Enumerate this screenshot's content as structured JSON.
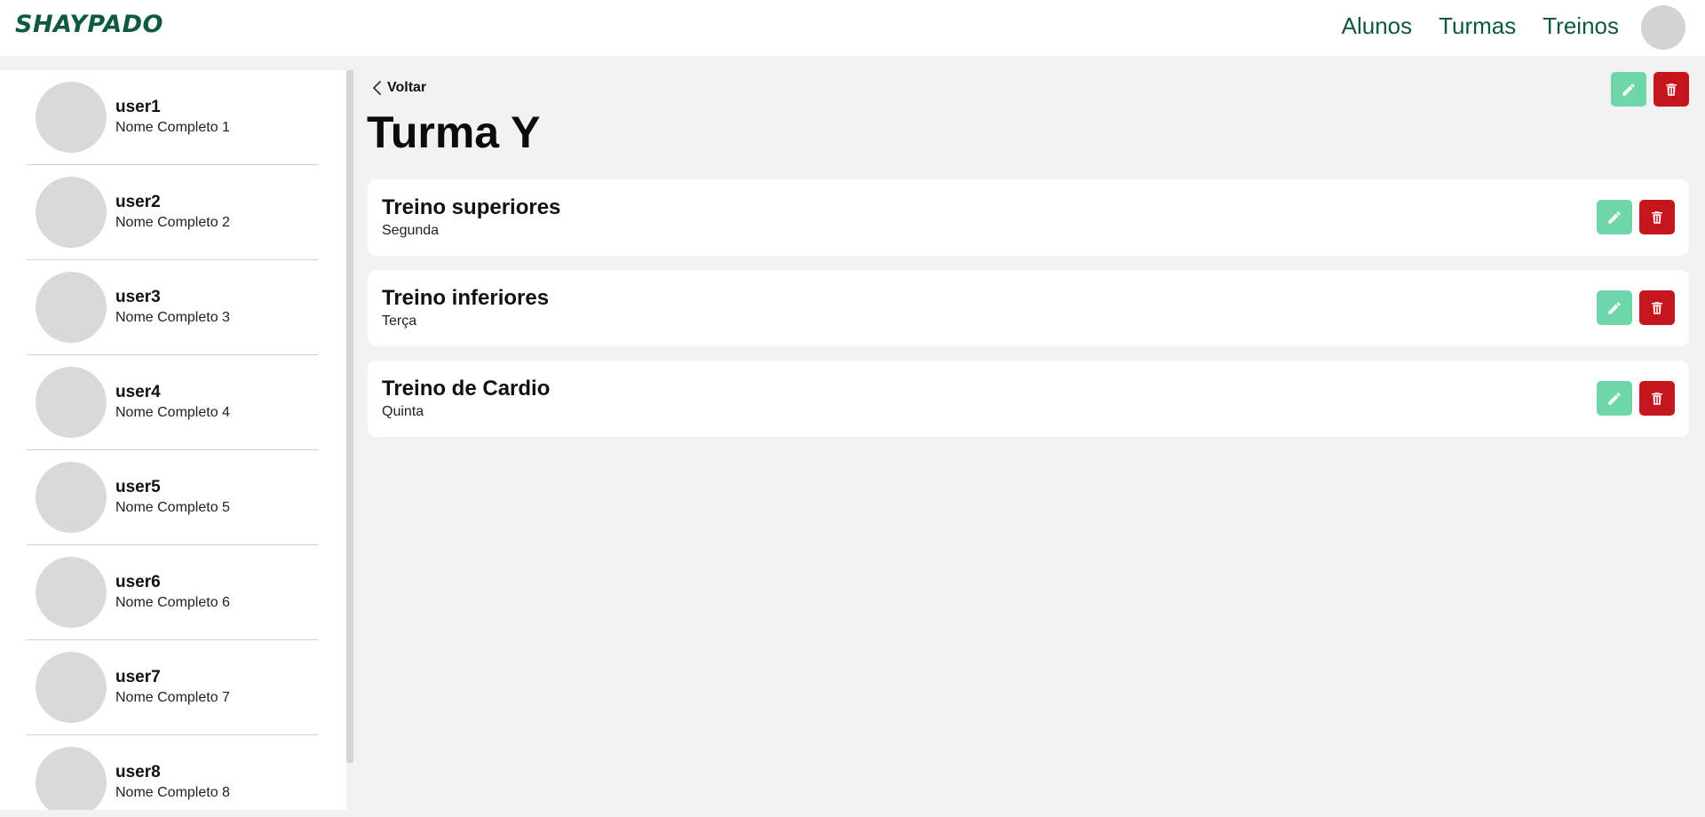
{
  "header": {
    "logo": "SHAYPADO",
    "nav": [
      "Alunos",
      "Turmas",
      "Treinos"
    ]
  },
  "sidebar": {
    "users": [
      {
        "username": "user1",
        "full_name": "Nome Completo 1"
      },
      {
        "username": "user2",
        "full_name": "Nome Completo 2"
      },
      {
        "username": "user3",
        "full_name": "Nome Completo 3"
      },
      {
        "username": "user4",
        "full_name": "Nome Completo 4"
      },
      {
        "username": "user5",
        "full_name": "Nome Completo 5"
      },
      {
        "username": "user6",
        "full_name": "Nome Completo 6"
      },
      {
        "username": "user7",
        "full_name": "Nome Completo 7"
      },
      {
        "username": "user8",
        "full_name": "Nome Completo 8"
      }
    ]
  },
  "main": {
    "back_label": "Voltar",
    "title": "Turma Y",
    "trainings": [
      {
        "name": "Treino superiores",
        "day": "Segunda"
      },
      {
        "name": "Treino inferiores",
        "day": "Terça"
      },
      {
        "name": "Treino de Cardio",
        "day": "Quinta"
      }
    ]
  },
  "colors": {
    "brand": "#0d5a3f",
    "edit": "#6fd6aa",
    "delete": "#c4161c"
  },
  "icons": {
    "edit": "pencil-icon",
    "delete": "trash-icon",
    "back": "chevron-left-icon"
  }
}
